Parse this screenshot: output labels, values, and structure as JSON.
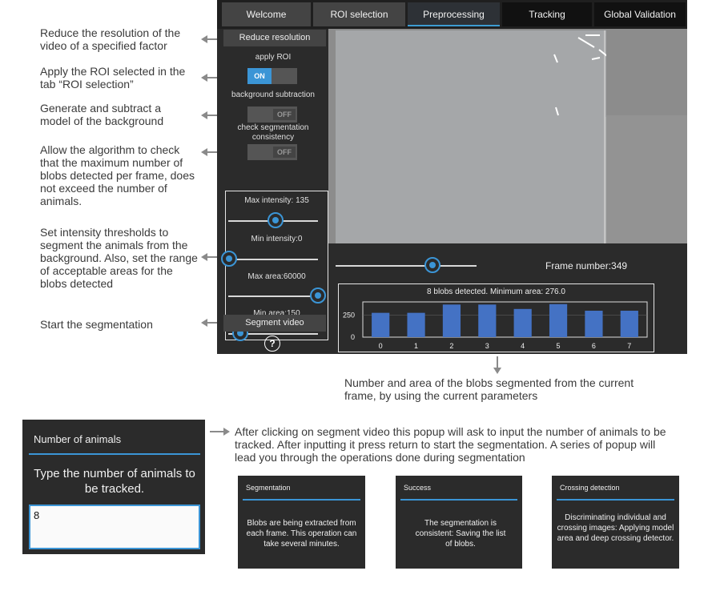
{
  "annotations": {
    "reduce": "Reduce the resolution of the video of a specified factor",
    "roi": "Apply the ROI selected in the tab “ROI selection”",
    "bg": "Generate and subtract a model of the background",
    "consistency": "Allow the algorithm to check that the maximum number of blobs detected per frame, does not exceed the number of animals.",
    "thresholds": "Set intensity thresholds to segment the animals from the background. Also, set the range of acceptable areas for the blobs detected",
    "segment": "Start the segmentation",
    "blobs": "Number and area of the blobs segmented from the current frame, by using the current parameters",
    "popup_note": "After clicking on segment video this popup will ask to input the number of animals to be tracked. After inputting it press return to start the segmentation. A series of popup will lead you through the operations done during segmentation"
  },
  "tabs": [
    "Welcome",
    "ROI selection",
    "Preprocessing",
    "Tracking",
    "Global Validation"
  ],
  "panel": {
    "reduce_btn": "Reduce resolution",
    "apply_roi": "apply ROI",
    "toggle_on": "ON",
    "toggle_off": "OFF",
    "bg_sub": "background subtraction",
    "check_seg": "check segmentation consistency",
    "max_int": "Max intensity: 135",
    "min_int": "Min intensity:0",
    "max_area": "Max area:60000",
    "min_area": "Min area:150",
    "segment_btn": "Segment video",
    "help": "?"
  },
  "sliders": {
    "max_intensity": 135,
    "min_intensity": 0,
    "max_area": 60000,
    "min_area": 150
  },
  "frame": {
    "label": "Frame number:349",
    "value": 349
  },
  "chart_data": {
    "type": "bar",
    "title": "8 blobs detected. Minimum area: 276.0",
    "categories": [
      "0",
      "1",
      "2",
      "3",
      "4",
      "5",
      "6",
      "7"
    ],
    "values": [
      276,
      276,
      370,
      370,
      320,
      375,
      300,
      300
    ],
    "ylim": [
      0,
      400
    ],
    "yticks": [
      "250",
      "0"
    ],
    "color": "#4472c4"
  },
  "popup_main": {
    "title": "Number of animals",
    "prompt": "Type the number of animals to be tracked.",
    "value": "8"
  },
  "popups": [
    {
      "title": "Segmentation",
      "body": "Blobs are being extracted from each frame. This operation can take several minutes."
    },
    {
      "title": "Success",
      "body": "The segmentation is consistent: Saving the list of blobs."
    },
    {
      "title": "Crossing detection",
      "body": "Discriminating individual and crossing images: Applying model area and deep crossing detector."
    }
  ],
  "colors": {
    "accent": "#3b95d6",
    "bar": "#4472c4",
    "panel": "#2b2b2b"
  }
}
